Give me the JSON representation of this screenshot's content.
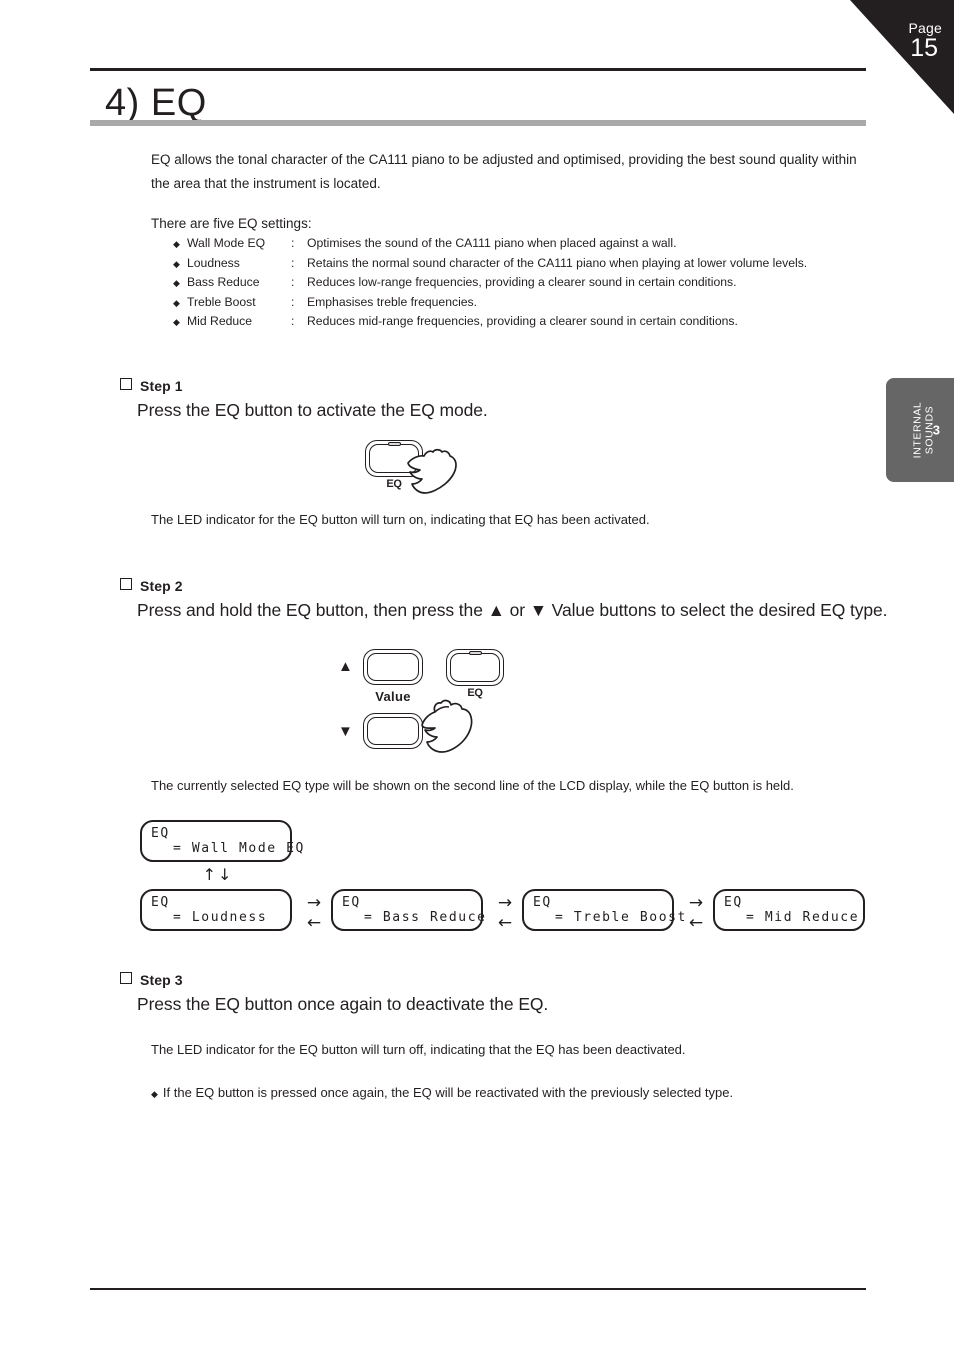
{
  "page": {
    "corner_label": "Page",
    "number": "15"
  },
  "side_tab": {
    "line1": "INTERNAL",
    "line2": "SOUNDS",
    "chapter": "3",
    "color": "#666666"
  },
  "section": {
    "title": "4) EQ",
    "rule_color": "#231f20",
    "title_bar_color": "#a9a9a9",
    "intro": "EQ allows the tonal character of the CA111 piano to be adjusted and optimised, providing the best sound quality within the area that the instrument is located.",
    "settings_intro": "There are five EQ settings:"
  },
  "settings": [
    {
      "bullet": "◆",
      "name": "Wall Mode EQ",
      "colon": ":",
      "desc": "Optimises the sound of the CA111 piano when placed against a wall."
    },
    {
      "bullet": "◆",
      "name": "Loudness",
      "colon": ":",
      "desc": "Retains the normal sound character of the CA111 piano when playing at lower volume levels."
    },
    {
      "bullet": "◆",
      "name": "Bass Reduce",
      "colon": ":",
      "desc": "Reduces low-range frequencies, providing a clearer sound in certain conditions."
    },
    {
      "bullet": "◆",
      "name": "Treble Boost",
      "colon": ":",
      "desc": "Emphasises treble frequencies."
    },
    {
      "bullet": "◆",
      "name": "Mid Reduce",
      "colon": ":",
      "desc": "Reduces mid-range frequencies, providing a clearer sound in certain conditions."
    }
  ],
  "step1": {
    "heading": "Step 1",
    "lead": "Press the EQ button to activate the EQ mode.",
    "note": "The LED indicator for the EQ button will turn on, indicating that EQ has been activated.",
    "button_label": "EQ"
  },
  "step2": {
    "heading": "Step 2",
    "lead": "Press and hold the EQ button, then press the ▲ or ▼ Value buttons to select the desired EQ type.",
    "note": "The currently selected EQ type will be shown on the second line of the LCD display, while the EQ button is held.",
    "value_label": "Value",
    "eq_label": "EQ",
    "up_triangle": "▲",
    "down_triangle": "▼"
  },
  "step3": {
    "heading": "Step 3",
    "lead": "Press the EQ button once again to deactivate the EQ.",
    "note": "The LED indicator for the EQ button will turn off, indicating that the EQ has been deactivated.",
    "bullet": "◆",
    "bullet_text": "If the EQ button is pressed once again, the EQ will be reactivated with the previously selected type."
  },
  "lcd_displays": [
    {
      "line1": "EQ",
      "line2": "= Wall Mode EQ"
    },
    {
      "line1": "EQ",
      "line2": "= Loudness"
    },
    {
      "line1": "EQ",
      "line2": "= Bass Reduce"
    },
    {
      "line1": "EQ",
      "line2": "= Treble Boost"
    },
    {
      "line1": "EQ",
      "line2": "= Mid Reduce"
    }
  ],
  "flow_arrows": {
    "vertical": "↑↓",
    "right": "→",
    "left": "←"
  }
}
